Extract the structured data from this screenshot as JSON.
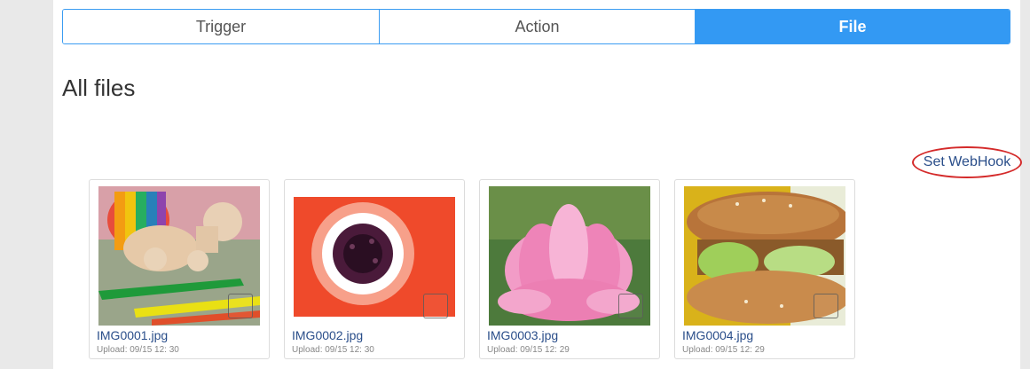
{
  "tabs": [
    {
      "label": "Trigger",
      "active": false
    },
    {
      "label": "Action",
      "active": false
    },
    {
      "label": "File",
      "active": true
    }
  ],
  "page_title": "All files",
  "webhook_link": "Set WebHook",
  "files": [
    {
      "name": "IMG0001.jpg",
      "upload_label": "Upload: 09/15 12: 30",
      "thumbnail": "toy-turtle-and-crayons"
    },
    {
      "name": "IMG0002.jpg",
      "upload_label": "Upload: 09/15 12: 30",
      "thumbnail": "red-anemone-flower"
    },
    {
      "name": "IMG0003.jpg",
      "upload_label": "Upload: 09/15 12: 29",
      "thumbnail": "pink-lotus-flower"
    },
    {
      "name": "IMG0004.jpg",
      "upload_label": "Upload: 09/15 12: 29",
      "thumbnail": "sesame-bagel-sandwich"
    }
  ],
  "colors": {
    "accent": "#3399f3",
    "link": "#2a4e8a",
    "highlight": "#d42a2a"
  }
}
